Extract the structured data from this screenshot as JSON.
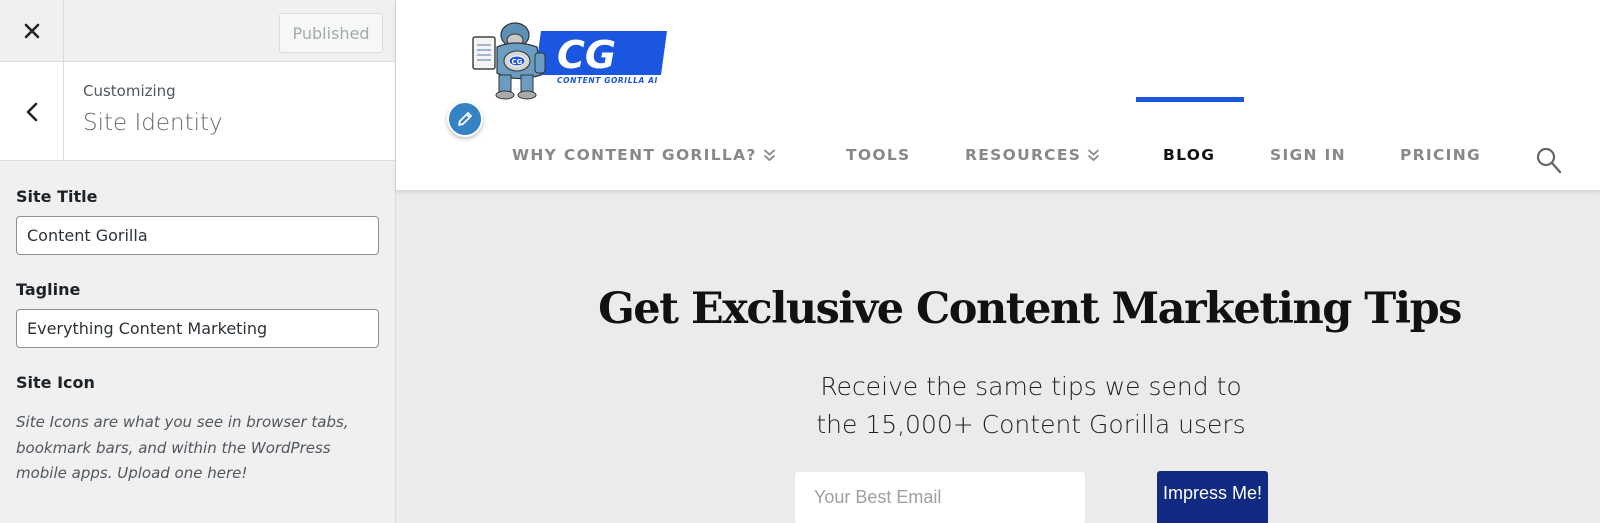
{
  "customizer": {
    "close_icon": "close-icon",
    "publish_button": "Published",
    "back_icon": "chevron-left-icon",
    "breadcrumb": "Customizing",
    "section_title": "Site Identity",
    "fields": {
      "site_title": {
        "label": "Site Title",
        "value": "Content Gorilla"
      },
      "tagline": {
        "label": "Tagline",
        "value": "Everything Content Marketing"
      }
    },
    "site_icon": {
      "label": "Site Icon",
      "description": "Site Icons are what you see in browser tabs, bookmark bars, and within the WordPress mobile apps. Upload one here!"
    }
  },
  "preview": {
    "logo": {
      "main_text": "CG",
      "suffix": "AI",
      "subtitle": "CONTENT GORILLA AI",
      "badge": "CG"
    },
    "edit_icon": "pencil-icon",
    "nav": [
      {
        "label": "Why Content Gorilla?",
        "has_dropdown": true,
        "active": false
      },
      {
        "label": "Tools",
        "has_dropdown": false,
        "active": false
      },
      {
        "label": "Resources",
        "has_dropdown": true,
        "active": false
      },
      {
        "label": "Blog",
        "has_dropdown": false,
        "active": true
      },
      {
        "label": "Sign In",
        "has_dropdown": false,
        "active": false
      },
      {
        "label": "Pricing",
        "has_dropdown": false,
        "active": false
      }
    ],
    "search_icon": "search-icon",
    "hero": {
      "title": "Get Exclusive Content Marketing Tips",
      "subtitle_line1": "Receive the same tips we send to",
      "subtitle_line2": "the 15,000+ Content Gorilla users"
    },
    "signup": {
      "email_placeholder": "Your Best Email",
      "email_value": "",
      "button_label": "Impress Me!"
    },
    "colors": {
      "accent": "#1a56e0",
      "button": "#0f2a80",
      "edit_shortcut": "#3582c4"
    }
  }
}
